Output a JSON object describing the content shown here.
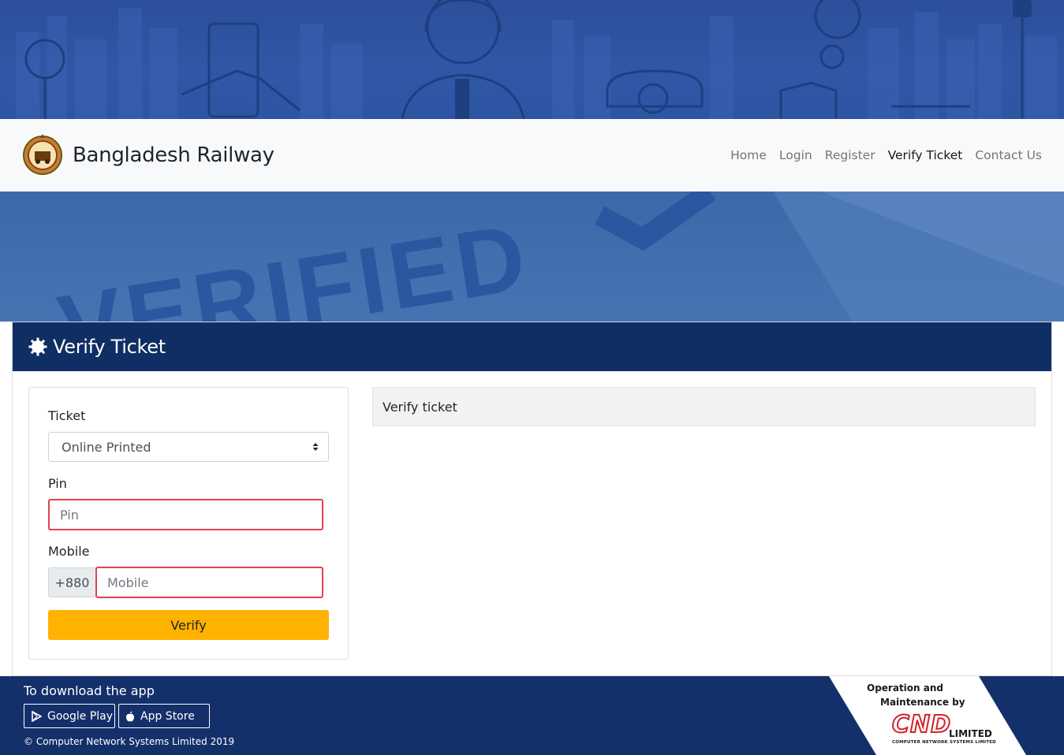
{
  "brand": {
    "name": "Bangladesh Railway",
    "logo_icon": "railway-emblem-icon"
  },
  "nav": {
    "items": [
      {
        "label": "Home",
        "active": false
      },
      {
        "label": "Login",
        "active": false
      },
      {
        "label": "Register",
        "active": false
      },
      {
        "label": "Verify Ticket",
        "active": true
      },
      {
        "label": "Contact Us",
        "active": false
      }
    ]
  },
  "banner": {
    "text": "VERIFIED"
  },
  "card": {
    "title": "Verify Ticket",
    "icon": "gear-icon"
  },
  "form": {
    "ticket_label": "Ticket",
    "ticket_selected": "Online Printed",
    "pin_label": "Pin",
    "pin_placeholder": "Pin",
    "mobile_label": "Mobile",
    "mobile_prefix": "+880",
    "mobile_placeholder": "Mobile",
    "verify_button": "Verify"
  },
  "result": {
    "text": "Verify ticket"
  },
  "footer": {
    "download_title": "To download the app",
    "google_play": "Google Play",
    "app_store": "App Store",
    "copyright": "© Computer Network Systems Limited 2019",
    "operation_line1": "Operation and",
    "operation_line2": "Maintenance by",
    "cnd_logo": "CND",
    "cnd_limited": "LIMITED",
    "cnd_fullname": "COMPUTER NETWORK SYSTEMS LIMITED"
  },
  "colors": {
    "header_dark": "#0f2e64",
    "footer": "#14306a",
    "accent_button": "#ffb300",
    "error_border": "#e0434f",
    "navbar_bg": "#f8f9fa"
  }
}
